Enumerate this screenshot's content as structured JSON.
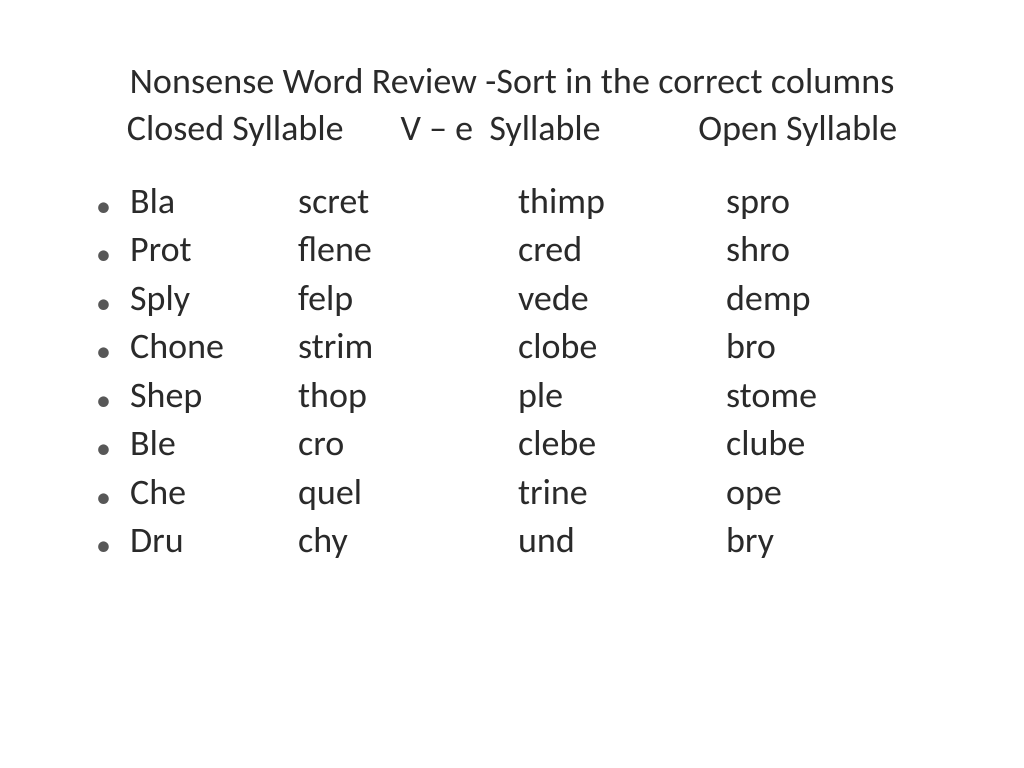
{
  "title": {
    "line1": "Nonsense Word Review -Sort in the correct columns",
    "line2_a": "Closed Syllable",
    "line2_b": "V – e  Syllable",
    "line2_c": "Open Syllable"
  },
  "rows": [
    {
      "c1": "Bla",
      "c2": "scret",
      "c3": "thimp",
      "c4": "spro"
    },
    {
      "c1": "Prot",
      "c2": "flene",
      "c3": "cred",
      "c4": "shro"
    },
    {
      "c1": "Sply",
      "c2": "felp",
      "c3": "vede",
      "c4": "demp"
    },
    {
      "c1": "Chone",
      "c2": "strim",
      "c3": "clobe",
      "c4": "bro"
    },
    {
      "c1": "Shep",
      "c2": "thop",
      "c3": "ple",
      "c4": "stome"
    },
    {
      "c1": "Ble",
      "c2": "cro",
      "c3": "clebe",
      "c4": "clube"
    },
    {
      "c1": "Che",
      "c2": "quel",
      "c3": "trine",
      "c4": "ope"
    },
    {
      "c1": "Dru",
      "c2": "chy",
      "c3": "und",
      "c4": "bry"
    }
  ]
}
